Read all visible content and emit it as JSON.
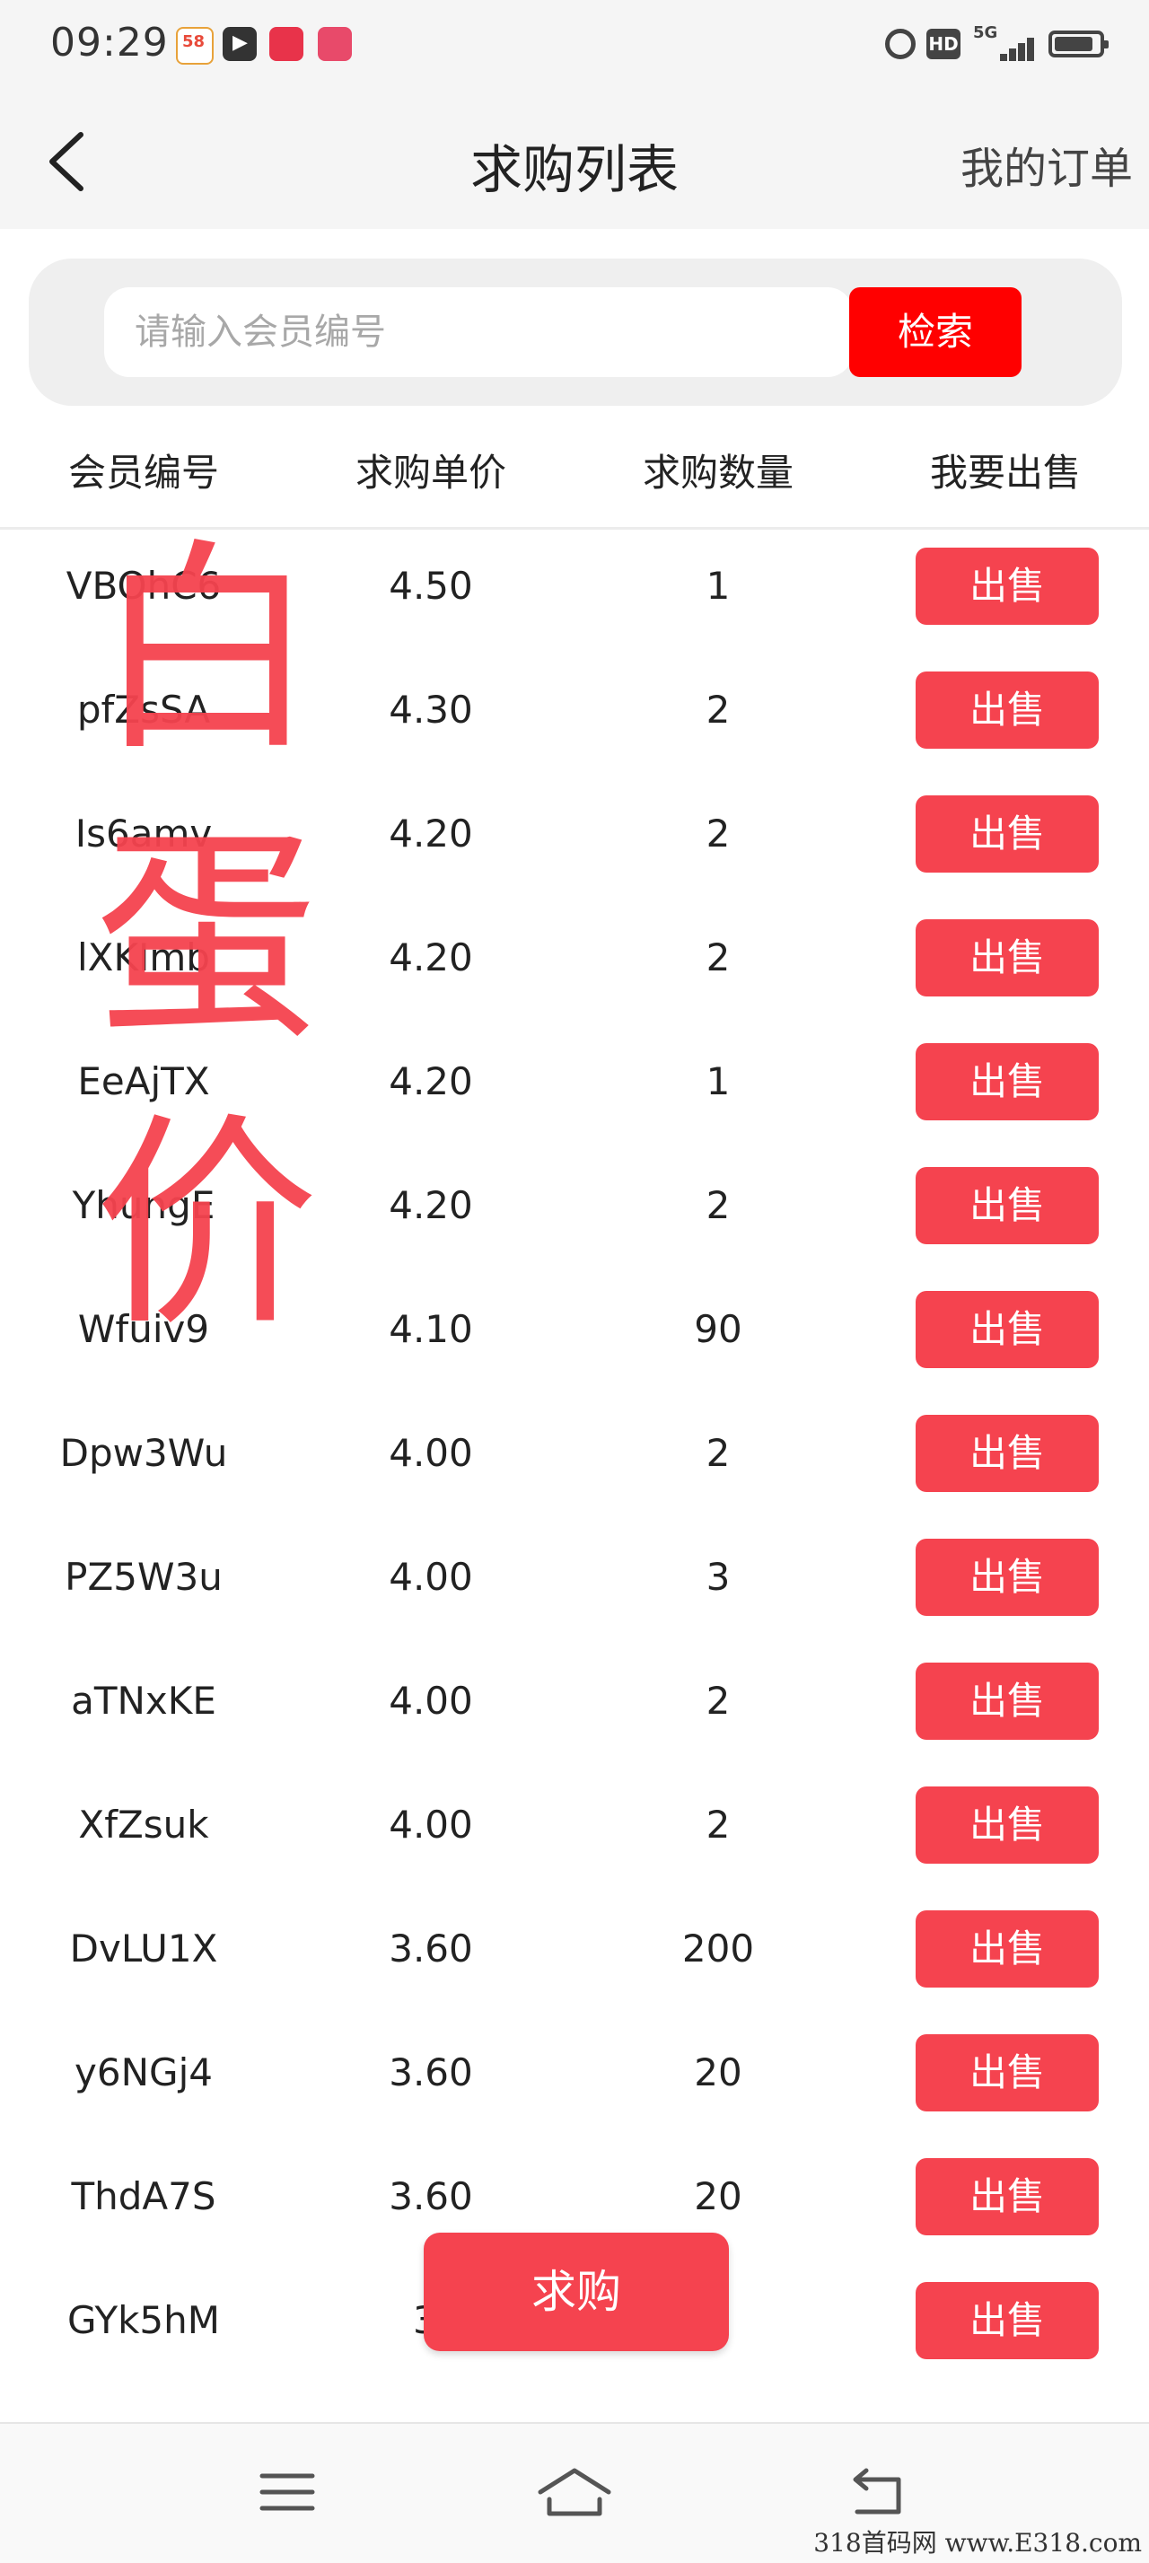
{
  "status_bar": {
    "time": "09:29",
    "app_icons": [
      "58-app-icon",
      "video-player-icon",
      "red-packet-icon",
      "camera-app-icon"
    ],
    "network": "5G",
    "hd_label": "HD"
  },
  "header": {
    "back_icon": "chevron-left-icon",
    "title": "求购列表",
    "my_orders": "我的订单"
  },
  "search": {
    "placeholder": "请输入会员编号",
    "button": "检索"
  },
  "table": {
    "columns": [
      "会员编号",
      "求购单价",
      "求购数量",
      "我要出售"
    ],
    "rows": [
      {
        "member": "VBOhC6",
        "price": "4.50",
        "qty": "1",
        "action": "出售"
      },
      {
        "member": "pfZsSA",
        "price": "4.30",
        "qty": "2",
        "action": "出售"
      },
      {
        "member": "Is6amv",
        "price": "4.20",
        "qty": "2",
        "action": "出售"
      },
      {
        "member": "lXKImb",
        "price": "4.20",
        "qty": "2",
        "action": "出售"
      },
      {
        "member": "EeAjTX",
        "price": "4.20",
        "qty": "1",
        "action": "出售"
      },
      {
        "member": "YhungE",
        "price": "4.20",
        "qty": "2",
        "action": "出售"
      },
      {
        "member": "Wfuiv9",
        "price": "4.10",
        "qty": "90",
        "action": "出售"
      },
      {
        "member": "Dpw3Wu",
        "price": "4.00",
        "qty": "2",
        "action": "出售"
      },
      {
        "member": "PZ5W3u",
        "price": "4.00",
        "qty": "3",
        "action": "出售"
      },
      {
        "member": "aTNxKE",
        "price": "4.00",
        "qty": "2",
        "action": "出售"
      },
      {
        "member": "XfZsuk",
        "price": "4.00",
        "qty": "2",
        "action": "出售"
      },
      {
        "member": "DvLU1X",
        "price": "3.60",
        "qty": "200",
        "action": "出售"
      },
      {
        "member": "y6NGj4",
        "price": "3.60",
        "qty": "20",
        "action": "出售"
      },
      {
        "member": "ThdA7S",
        "price": "3.60",
        "qty": "20",
        "action": "出售"
      },
      {
        "member": "GYk5hM",
        "price": "3.",
        "qty": "0",
        "action": "出售"
      }
    ]
  },
  "overlay_text": [
    "白",
    "蛋",
    "价"
  ],
  "buy_button": "求购",
  "nav": {
    "icons": [
      "menu-icon",
      "home-icon",
      "back-icon"
    ]
  },
  "footer": "318首码网 www.E318.com",
  "colors": {
    "accent": "#f5434f",
    "search_button": "#ff0000",
    "header_bg": "#f5f5f5"
  }
}
